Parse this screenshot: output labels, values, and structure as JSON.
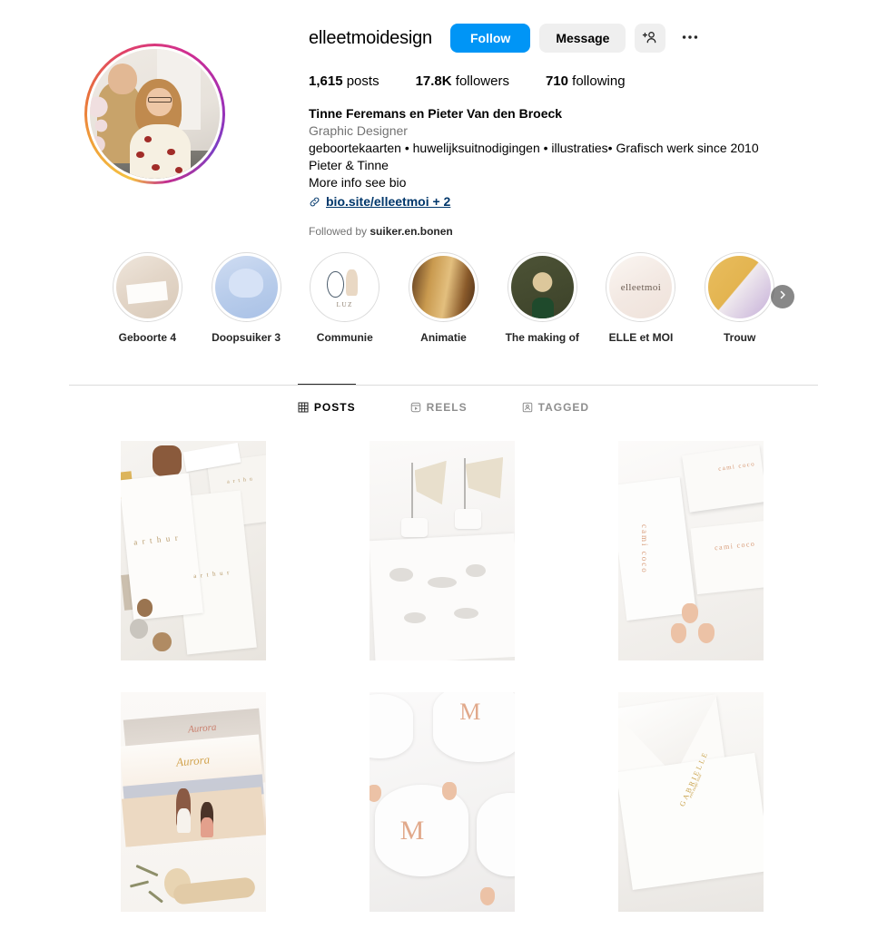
{
  "profile": {
    "username": "elleetmoidesign",
    "full_name": "Tinne Feremans en Pieter Van den Broeck",
    "category": "Graphic Designer",
    "bio_lines": [
      "geboortekaarten • huwelijksuitnodigingen • illustraties• Grafisch werk since 2010",
      "Pieter & Tinne",
      "More info see bio"
    ],
    "link_text": "bio.site/elleetmoi + 2",
    "link_icon": "link-icon",
    "followed_by_prefix": "Followed by",
    "followed_by_user": "suiker.en.bonen",
    "avatar_alt": "elleetmoidesign profile photo",
    "has_story_ring": true
  },
  "actions": {
    "follow_label": "Follow",
    "message_label": "Message",
    "add_person_icon": "add-person-icon",
    "more_options_icon": "more-options-icon"
  },
  "stats": [
    {
      "value": "1,615",
      "label": "posts"
    },
    {
      "value": "17.8K",
      "label": "followers"
    },
    {
      "value": "710",
      "label": "following"
    }
  ],
  "highlights": [
    {
      "label": "Geboorte 4",
      "cover": "hc-geboorte"
    },
    {
      "label": "Doopsuiker 3",
      "cover": "hc-doopsuiker"
    },
    {
      "label": "Communie",
      "cover": "hc-communie"
    },
    {
      "label": "Animatie",
      "cover": "hc-animatie"
    },
    {
      "label": "The making of",
      "cover": "hc-making"
    },
    {
      "label": "ELLE et MOI",
      "cover": "hc-elle"
    },
    {
      "label": "Trouw",
      "cover": "hc-trouw"
    }
  ],
  "highlights_next_icon": "chevron-right-icon",
  "tabs": [
    {
      "label": "POSTS",
      "icon": "grid-icon",
      "active": true
    },
    {
      "label": "REELS",
      "icon": "reels-icon",
      "active": false
    },
    {
      "label": "TAGGED",
      "icon": "tagged-icon",
      "active": false
    }
  ],
  "posts": [
    {
      "alt": "arthur birth announcement stationery with chocolate",
      "art": "p1"
    },
    {
      "alt": "embossed white card with ribbon cake pops",
      "art": "p2"
    },
    {
      "alt": "cami coco coral letterpress stationery set",
      "art": "p3"
    },
    {
      "alt": "Aurora beach illustration birth cards with wooden spoon",
      "art": "p4"
    },
    {
      "alt": "rose gold M monogram oval cards",
      "art": "p5"
    },
    {
      "alt": "GABRIELLE gold foil card with envelope",
      "art": "p6"
    }
  ],
  "colors": {
    "follow_blue": "#0095f6",
    "button_grey": "#efefef",
    "link_navy": "#00376b",
    "muted_text": "#737373",
    "divider": "#dbdbdb",
    "text_primary": "#000000"
  }
}
